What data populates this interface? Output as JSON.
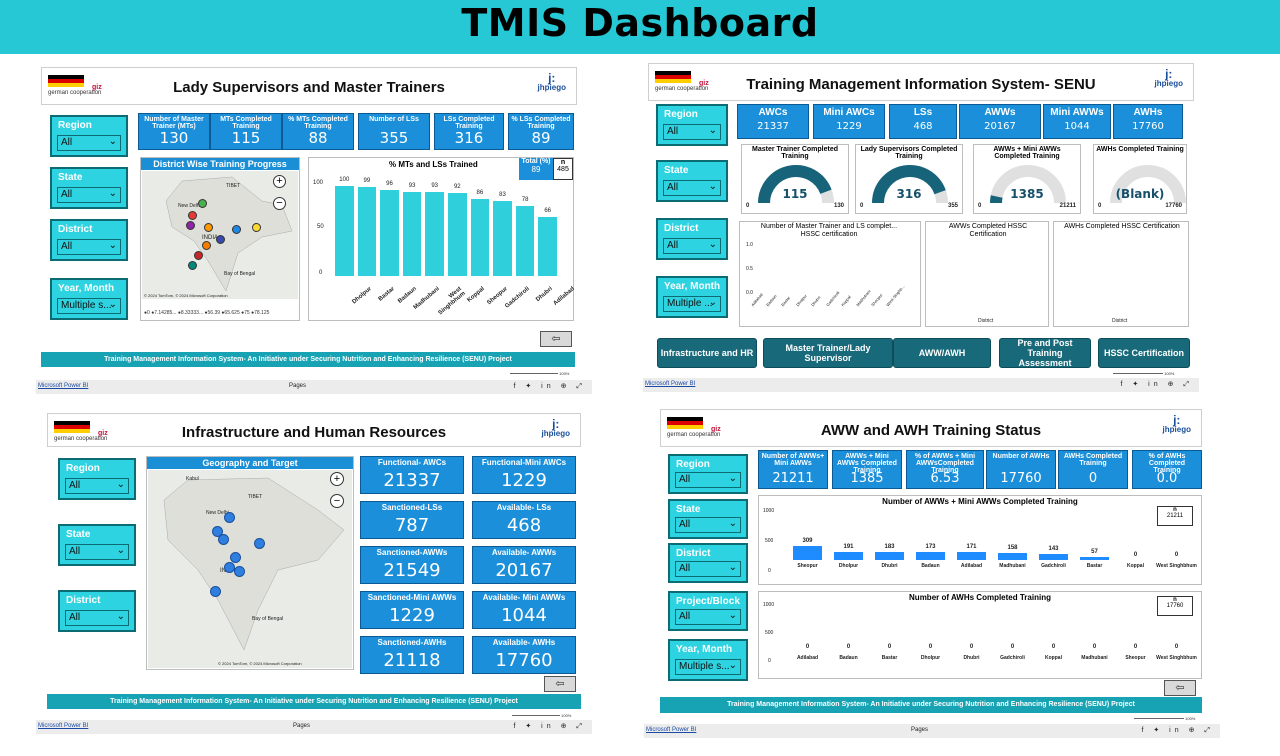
{
  "title": "TMIS Dashboard",
  "common": {
    "powerbi_link": "Microsoft Power BI",
    "pages_label": "Pages",
    "zoom": "100%",
    "footer_text": "Training Management Information System- An Initiative under Securing Nutrition and Enhancing Resilience (SENU) Project",
    "german_coop": "german cooperation",
    "giz": "giz",
    "jhpiego": "jhpiego",
    "back_icon": "back-arrow-icon"
  },
  "panel_ls": {
    "header_title": "Lady Supervisors and Master Trainers",
    "slicers": [
      {
        "label": "Region",
        "value": "All"
      },
      {
        "label": "State",
        "value": "All"
      },
      {
        "label": "District",
        "value": "All"
      },
      {
        "label": "Year, Month",
        "value": "Multiple s..."
      }
    ],
    "kpis": [
      {
        "label": "Number of Master Trainer (MTs)",
        "value": "130"
      },
      {
        "label": "MTs Completed Training",
        "value": "115"
      },
      {
        "label": "% MTs Completed Training",
        "value": "88"
      },
      {
        "label": "Number of LSs",
        "value": "355"
      },
      {
        "label": "LSs Completed Training",
        "value": "316"
      },
      {
        "label": "% LSs Completed Training",
        "value": "89"
      }
    ],
    "map_title": "District Wise Training Progress",
    "map_labels": {
      "delhi": "New Delhi",
      "india": "INDIA",
      "bay": "Bay of Bengal",
      "tibet": "TIBET"
    },
    "map_legend": "●0 ●7.14285... ●8.33333... ●56.39 ●65.625 ●75 ●78.125",
    "map_copyright": "© 2024 TomTom, © 2024 Microsoft Corporation",
    "map_terms": "Terms",
    "chart_title": "% MTs and LSs Trained",
    "total_label": "Total (%)",
    "total_value": "89",
    "n_label": "n",
    "n_value": "485",
    "chart_data": {
      "type": "bar",
      "categories": [
        "Dholpur",
        "Bastar",
        "Badaun",
        "Madhubani",
        "West Singhbhum",
        "Koppal",
        "Sheopur",
        "Gadchiroli",
        "Dhubri",
        "Adilabad"
      ],
      "values": [
        100,
        99,
        96,
        93,
        93,
        92,
        86,
        83,
        78,
        66
      ],
      "ylim": [
        0,
        100
      ],
      "yticks": [
        "100",
        "50",
        "0"
      ]
    }
  },
  "panel_senu": {
    "header_title": "Training Management Information System- SENU",
    "slicers": [
      {
        "label": "Region",
        "value": "All"
      },
      {
        "label": "State",
        "value": "All"
      },
      {
        "label": "District",
        "value": "All"
      },
      {
        "label": "Year, Month",
        "value": "Multiple ..."
      }
    ],
    "kpis": [
      {
        "label": "AWCs",
        "value": "21337"
      },
      {
        "label": "Mini AWCs",
        "value": "1229"
      },
      {
        "label": "LSs",
        "value": "468"
      },
      {
        "label": "AWWs",
        "value": "20167"
      },
      {
        "label": "Mini AWWs",
        "value": "1044"
      },
      {
        "label": "AWHs",
        "value": "17760"
      }
    ],
    "gauges": [
      {
        "title": "Master Trainer Completed Training",
        "value": "115",
        "min": "0",
        "max": "130",
        "fraction": 0.885
      },
      {
        "title": "Lady Supervisors Completed Training",
        "value": "316",
        "min": "0",
        "max": "355",
        "fraction": 0.89
      },
      {
        "title": "AWWs + Mini AWWs Completed Training",
        "value": "1385",
        "min": "0",
        "max": "21211",
        "fraction": 0.065
      },
      {
        "title": "AWHs Completed Training",
        "value": "(Blank)",
        "min": "0",
        "max": "17760",
        "fraction": 0
      }
    ],
    "cert_titles": [
      "Number of Master Trainer and LS complet... HSSC certification",
      "AWWs Completed HSSC Certification",
      "AWHs Completed HSSC Certification"
    ],
    "cert_y": [
      "1.0",
      "0.5",
      "0.0"
    ],
    "cert_districts": [
      "Adilabad",
      "Badaun",
      "Bastar",
      "Dholpur",
      "Dhubri",
      "Gadchiroli",
      "Koppal",
      "Madhubani",
      "Sheopur",
      "West Singhb..."
    ],
    "cert_axis": "District",
    "nav_buttons": [
      "Infrastructure and HR",
      "Master Trainer/Lady Supervisor",
      "AWW/AWH",
      "Pre and Post Training Assessment",
      "HSSC Certification"
    ]
  },
  "panel_infra": {
    "header_title": "Infrastructure and Human Resources",
    "slicers": [
      {
        "label": "Region",
        "value": "All"
      },
      {
        "label": "State",
        "value": "All"
      },
      {
        "label": "District",
        "value": "All"
      }
    ],
    "map_title": "Geography and Target",
    "map_labels": {
      "delhi": "New Delhi",
      "india": "INDIA",
      "bay": "Bay of Bengal",
      "kabul": "Kabul",
      "tibet": "TIBET"
    },
    "map_copyright": "© 2024 TomTom, © 2024 Microsoft Corporation",
    "kpis": [
      {
        "label": "Functional- AWCs",
        "value": "21337"
      },
      {
        "label": "Functional-Mini AWCs",
        "value": "1229"
      },
      {
        "label": "Sanctioned-LSs",
        "value": "787"
      },
      {
        "label": "Available- LSs",
        "value": "468"
      },
      {
        "label": "Sanctioned-AWWs",
        "value": "21549"
      },
      {
        "label": "Available- AWWs",
        "value": "20167"
      },
      {
        "label": "Sanctioned-Mini AWWs",
        "value": "1229"
      },
      {
        "label": "Available- Mini AWWs",
        "value": "1044"
      },
      {
        "label": "Sanctioned-AWHs",
        "value": "21118"
      },
      {
        "label": "Available- AWHs",
        "value": "17760"
      }
    ]
  },
  "panel_aww": {
    "header_title": "AWW and AWH Training Status",
    "slicers": [
      {
        "label": "Region",
        "value": "All"
      },
      {
        "label": "State",
        "value": "All"
      },
      {
        "label": "District",
        "value": "All"
      },
      {
        "label": "Project/Block",
        "value": "All"
      },
      {
        "label": "Year, Month",
        "value": "Multiple s..."
      }
    ],
    "kpis": [
      {
        "label": "Number of AWWs+ Mini AWWs",
        "value": "21211"
      },
      {
        "label": "AWWs + Mini AWWs Completed Training",
        "value": "1385"
      },
      {
        "label": "% of AWWs + Mini AWWsCompleted Training",
        "value": "6.53"
      },
      {
        "label": "Number of AWHs",
        "value": "17760"
      },
      {
        "label": "AWHs Completed Training",
        "value": "0"
      },
      {
        "label": "% of AWHs Completed Training",
        "value": "0.0"
      }
    ],
    "chart1_title": "Number of AWWs + Mini AWWs Completed Training",
    "chart1_n_label": "n",
    "chart1_n_value": "21211",
    "chart2_title": "Number of AWHs Completed Training",
    "chart2_n_label": "n",
    "chart2_n_value": "17760",
    "y_ticks": [
      "1000",
      "500",
      "0"
    ],
    "chart_data": [
      {
        "type": "bar",
        "categories": [
          "Sheopur",
          "Dholpur",
          "Dhubri",
          "Badaun",
          "Adilabad",
          "Madhubani",
          "Gadchiroli",
          "Bastar",
          "Koppal",
          "West Singhbhum"
        ],
        "values": [
          309,
          191,
          183,
          173,
          171,
          158,
          143,
          57,
          0,
          0
        ],
        "ylim": [
          0,
          1000
        ]
      },
      {
        "type": "bar",
        "categories": [
          "Adilabad",
          "Badaun",
          "Bastar",
          "Dholpur",
          "Dhubri",
          "Gadchiroli",
          "Koppal",
          "Madhubani",
          "Sheopur",
          "West Singhbhum"
        ],
        "values": [
          0,
          0,
          0,
          0,
          0,
          0,
          0,
          0,
          0,
          0
        ],
        "ylim": [
          0,
          1000
        ]
      }
    ]
  }
}
